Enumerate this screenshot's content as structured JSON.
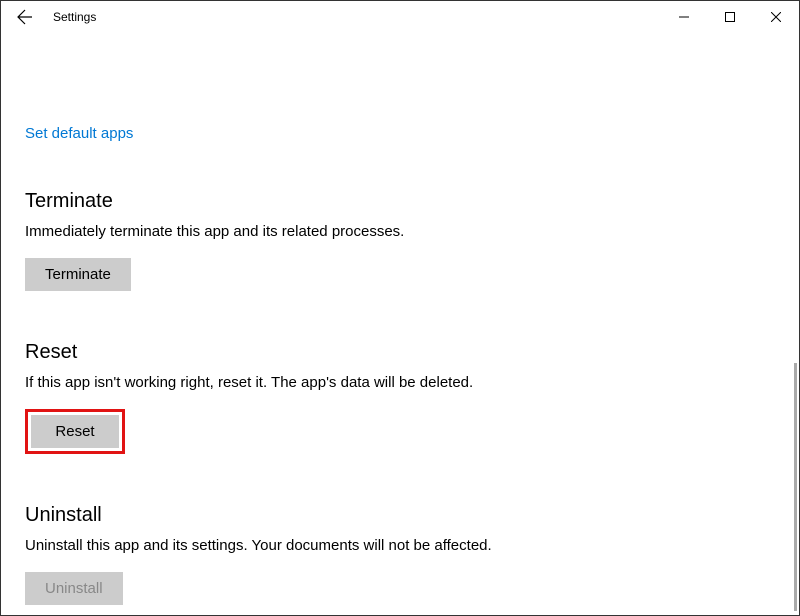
{
  "titlebar": {
    "title": "Settings"
  },
  "link": {
    "set_default_apps": "Set default apps"
  },
  "terminate": {
    "heading": "Terminate",
    "description": "Immediately terminate this app and its related processes.",
    "button": "Terminate"
  },
  "reset": {
    "heading": "Reset",
    "description": "If this app isn't working right, reset it. The app's data will be deleted.",
    "button": "Reset"
  },
  "uninstall": {
    "heading": "Uninstall",
    "description": "Uninstall this app and its settings. Your documents will not be affected.",
    "button": "Uninstall"
  }
}
